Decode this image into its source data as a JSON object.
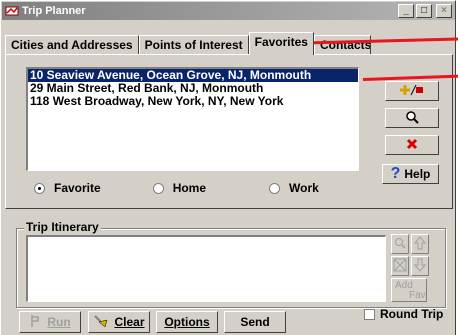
{
  "window": {
    "title": "Trip Planner",
    "controls": {
      "minimize": "_",
      "maximize": "□",
      "close": "×"
    }
  },
  "tabs": [
    {
      "label": "Cities and Addresses"
    },
    {
      "label": "Points of Interest"
    },
    {
      "label": "Favorites",
      "active": true
    },
    {
      "label": "Contacts"
    }
  ],
  "favorites": {
    "items": [
      "10 Seaview Avenue, Ocean Grove, NJ, Monmouth",
      "29 Main Street, Red Bank, NJ, Monmouth",
      "118 West Broadway, New York, NY, New York"
    ],
    "selected_index": 0,
    "help_label": "Help",
    "radios": [
      {
        "label": "Favorite",
        "checked": true
      },
      {
        "label": "Home",
        "checked": false
      },
      {
        "label": "Work",
        "checked": false
      }
    ]
  },
  "itinerary": {
    "label": "Trip Itinerary",
    "add_fav_label": [
      "Add",
      "Fav"
    ]
  },
  "bottom": {
    "run_label": "Run",
    "clear_label": "Clear",
    "options_label": "Options",
    "send_label": "Send",
    "round_trip_label": "Round Trip"
  },
  "colors": {
    "selection": "#0a246a",
    "annotation_red": "#e8161f",
    "help_blue": "#1f4fbf"
  }
}
